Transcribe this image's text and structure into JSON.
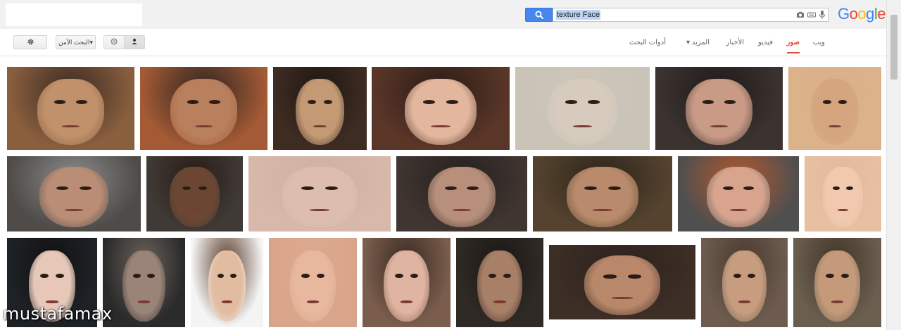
{
  "search": {
    "query": "texture Face"
  },
  "logo": {
    "text": "Google",
    "letters": [
      {
        "ch": "G",
        "color": "#4285f4"
      },
      {
        "ch": "o",
        "color": "#ea4335"
      },
      {
        "ch": "o",
        "color": "#fbbc05"
      },
      {
        "ch": "g",
        "color": "#4285f4"
      },
      {
        "ch": "l",
        "color": "#34a853"
      },
      {
        "ch": "e",
        "color": "#ea4335"
      }
    ]
  },
  "toolbar": {
    "safesearch_label": "البحث الآمن",
    "tabs": [
      "ويب",
      "صور",
      "فيديو",
      "الأخبار",
      "المزيد",
      "أدوات البحث"
    ],
    "active_tab_index": 1
  },
  "watermark": "mustafamax",
  "results": [
    {
      "bg": "#8a5f3e",
      "skin": "#c0916a",
      "hair": "#3a2a22"
    },
    {
      "bg": "#a45a35",
      "skin": "#b9805e",
      "hair": "#2c2420"
    },
    {
      "bg": "#3e2c22",
      "skin": "#c39a74",
      "hair": "#1e1612"
    },
    {
      "bg": "#5a3628",
      "skin": "#e2b79d",
      "hair": "#2a1c16"
    },
    {
      "bg": "#c9c3b8",
      "skin": "#d6cbbd",
      "hair": "#cfc6b9"
    },
    {
      "bg": "#3b3330",
      "skin": "#c99a86",
      "hair": "#1f1a18"
    },
    {
      "bg": "#dcb28a",
      "skin": "#d4a57f",
      "hair": "#d9b08a"
    },
    {
      "bg": "#4e4b48",
      "skin": "#b98d76",
      "hair": "#8c8c8c"
    },
    {
      "bg": "#3f3a36",
      "skin": "#6b4733",
      "hair": "#2a1a14"
    },
    {
      "bg": "#d7b8ab",
      "skin": "#dcbdb0",
      "hair": "#cdb0a4"
    },
    {
      "bg": "#403530",
      "skin": "#b88f7b",
      "hair": "#24201e"
    },
    {
      "bg": "#55432f",
      "skin": "#b98a6c",
      "hair": "#2d2419"
    },
    {
      "bg": "#4f4f4f",
      "skin": "#d8a48e",
      "hair": "#b3582d"
    },
    {
      "bg": "#e7bfa3",
      "skin": "#f0c9ae",
      "hair": "#e2b99d"
    },
    {
      "bg": "#1e2226",
      "skin": "#e6c7b8",
      "hair": "#111"
    },
    {
      "bg": "#2a2a2a",
      "skin": "#9a8478",
      "hair": "#6d625c"
    },
    {
      "bg": "#f4f4f4",
      "skin": "#e2bca0",
      "hair": "#5a3b2a"
    },
    {
      "bg": "#d9a58a",
      "skin": "#e7b89e",
      "hair": "#dcaa8f"
    },
    {
      "bg": "#7a5d4d",
      "skin": "#dfb4a0",
      "hair": "#3a2a22"
    },
    {
      "bg": "#2f2a26",
      "skin": "#a87f67",
      "hair": "#1b1714"
    },
    {
      "bg": "#3d2e26",
      "skin": "#b9876a",
      "hair": "#2c221c"
    },
    {
      "bg": "#6c5b4e",
      "skin": "#c89d7f",
      "hair": "#4a3a2e"
    },
    {
      "bg": "#6a5e4f",
      "skin": "#c49a7a",
      "hair": "#403428"
    }
  ]
}
